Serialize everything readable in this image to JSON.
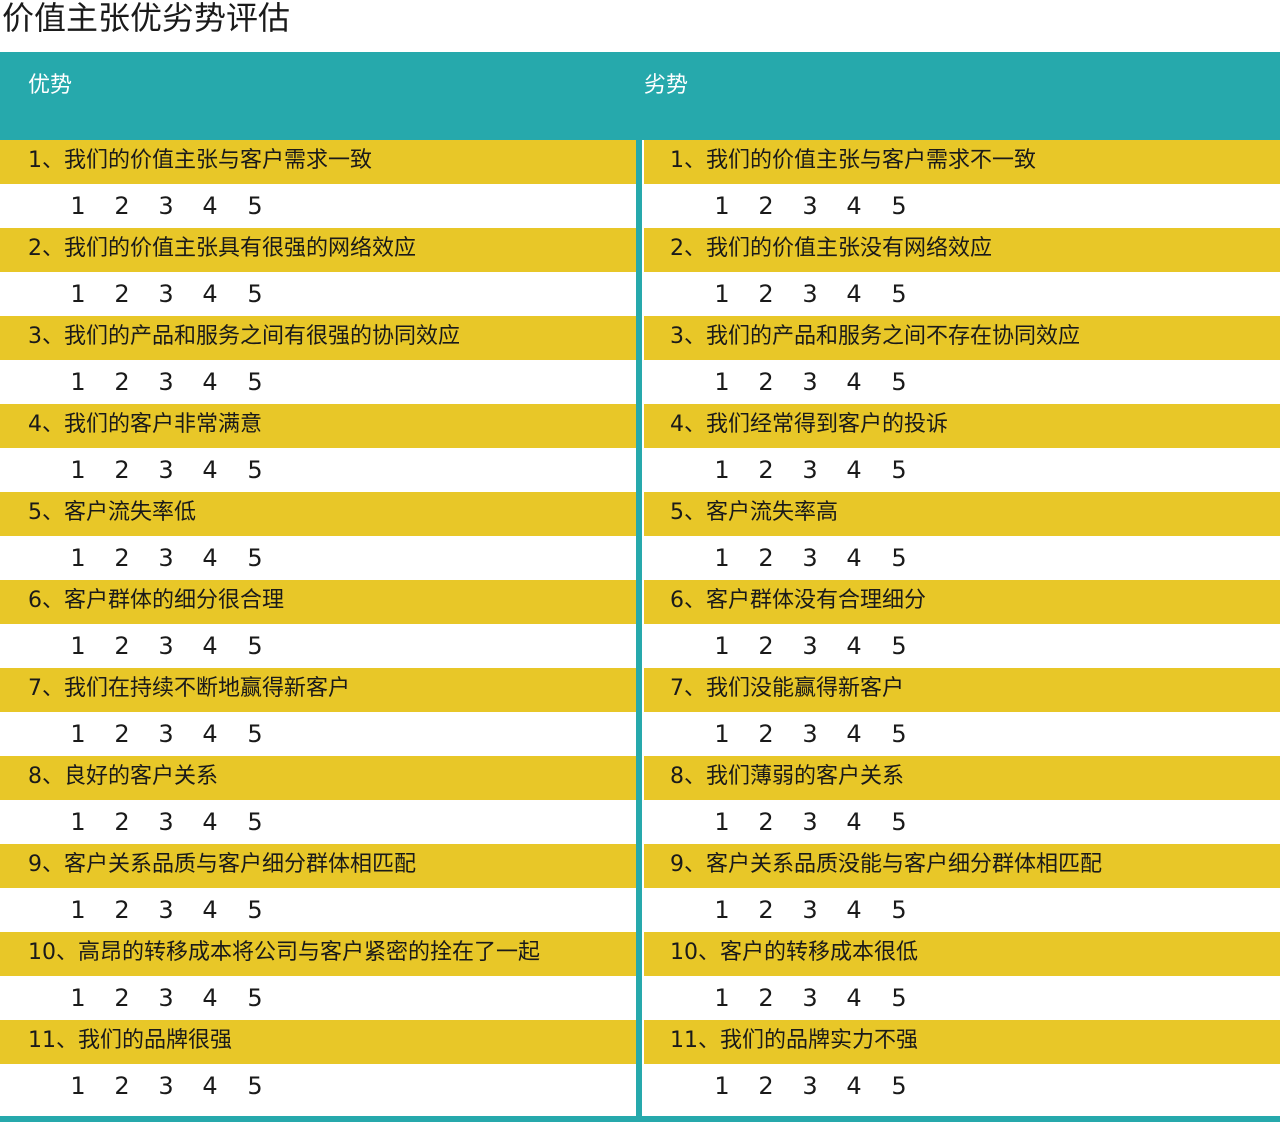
{
  "title": "价值主张优劣势评估",
  "colors": {
    "accent": "#26a9ac",
    "statement_bg": "#e8c728",
    "text": "#1a1a1a"
  },
  "header": {
    "left": "优势",
    "right": "劣势"
  },
  "scale": [
    "1",
    "2",
    "3",
    "4",
    "5"
  ],
  "strengths": [
    "1、我们的价值主张与客户需求一致",
    "2、我们的价值主张具有很强的网络效应",
    "3、我们的产品和服务之间有很强的协同效应",
    "4、我们的客户非常满意",
    "5、客户流失率低",
    "6、客户群体的细分很合理",
    "7、我们在持续不断地赢得新客户",
    "8、良好的客户关系",
    "9、客户关系品质与客户细分群体相匹配",
    "10、高昂的转移成本将公司与客户紧密的拴在了一起",
    "11、我们的品牌很强"
  ],
  "weaknesses": [
    "1、我们的价值主张与客户需求不一致",
    "2、我们的价值主张没有网络效应",
    "3、我们的产品和服务之间不存在协同效应",
    "4、我们经常得到客户的投诉",
    "5、客户流失率高",
    "6、客户群体没有合理细分",
    "7、我们没能赢得新客户",
    "8、我们薄弱的客户关系",
    "9、客户关系品质没能与客户细分群体相匹配",
    "10、客户的转移成本很低",
    "11、我们的品牌实力不强"
  ]
}
